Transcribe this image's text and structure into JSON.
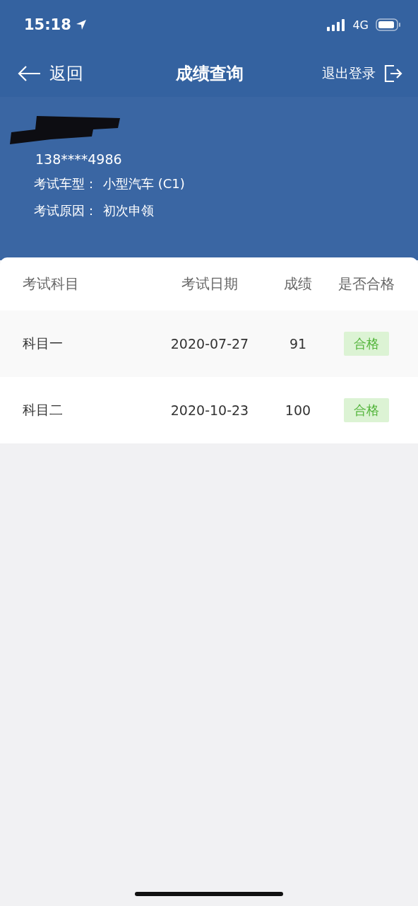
{
  "status_bar": {
    "time": "15:18",
    "network": "4G"
  },
  "nav": {
    "back": "返回",
    "title": "成绩查询",
    "logout": "退出登录"
  },
  "profile": {
    "phone": "138****4986",
    "fields": [
      {
        "label": "考试车型：",
        "value": "小型汽车 (C1)"
      },
      {
        "label": "考试原因：",
        "value": "初次申领"
      }
    ]
  },
  "table": {
    "columns": [
      "考试科目",
      "考试日期",
      "成绩",
      "是否合格"
    ],
    "rows": [
      {
        "subject": "科目一",
        "date": "2020-07-27",
        "score": "91",
        "result": "合格",
        "passed": true
      },
      {
        "subject": "科目二",
        "date": "2020-10-23",
        "score": "100",
        "result": "合格",
        "passed": true
      }
    ]
  }
}
